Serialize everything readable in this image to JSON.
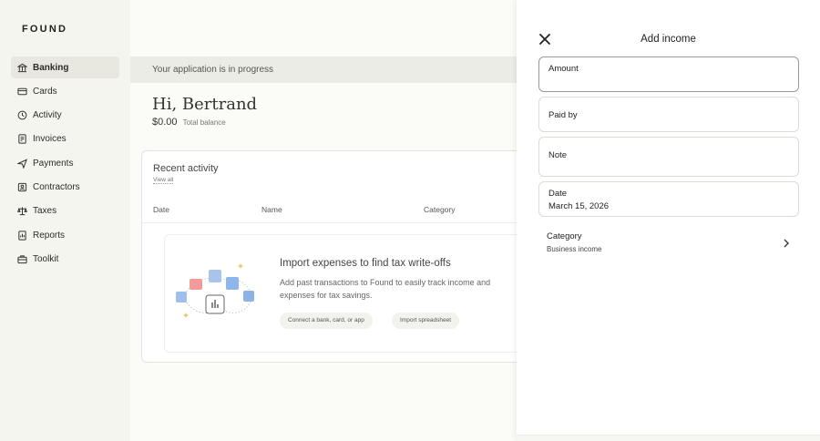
{
  "brand": {
    "logo": "FOUND"
  },
  "sidebar": {
    "items": [
      {
        "label": "Banking",
        "icon": "bank-icon",
        "active": true
      },
      {
        "label": "Cards",
        "icon": "card-icon"
      },
      {
        "label": "Activity",
        "icon": "clock-icon"
      },
      {
        "label": "Invoices",
        "icon": "invoice-icon"
      },
      {
        "label": "Payments",
        "icon": "send-icon"
      },
      {
        "label": "Contractors",
        "icon": "contractor-icon"
      },
      {
        "label": "Taxes",
        "icon": "scale-icon"
      },
      {
        "label": "Reports",
        "icon": "report-icon"
      },
      {
        "label": "Toolkit",
        "icon": "toolkit-icon"
      }
    ]
  },
  "main": {
    "banner": "Your application is in progress",
    "greeting": "Hi, Bertrand",
    "balance_amount": "$0.00",
    "balance_label": "Total balance",
    "recent": {
      "title": "Recent activity",
      "view_all": "View all",
      "columns": [
        "Date",
        "Name",
        "Category"
      ]
    },
    "empty_state": {
      "title": "Import expenses to find tax write-offs",
      "description": "Add past transactions to Found to easily track income and expenses for tax savings.",
      "connect_button": "Connect a bank, card, or app",
      "import_button": "Import spreadsheet"
    }
  },
  "drawer": {
    "title": "Add income",
    "fields": {
      "amount_label": "Amount",
      "paid_by_label": "Paid by",
      "note_label": "Note",
      "date_label": "Date",
      "date_value": "March 15, 2026"
    },
    "category": {
      "label": "Category",
      "value": "Business income"
    }
  },
  "colors": {
    "accent": "#2b2b2b",
    "sidebar_active": "#e8e8e0",
    "banner": "#ecece6"
  }
}
